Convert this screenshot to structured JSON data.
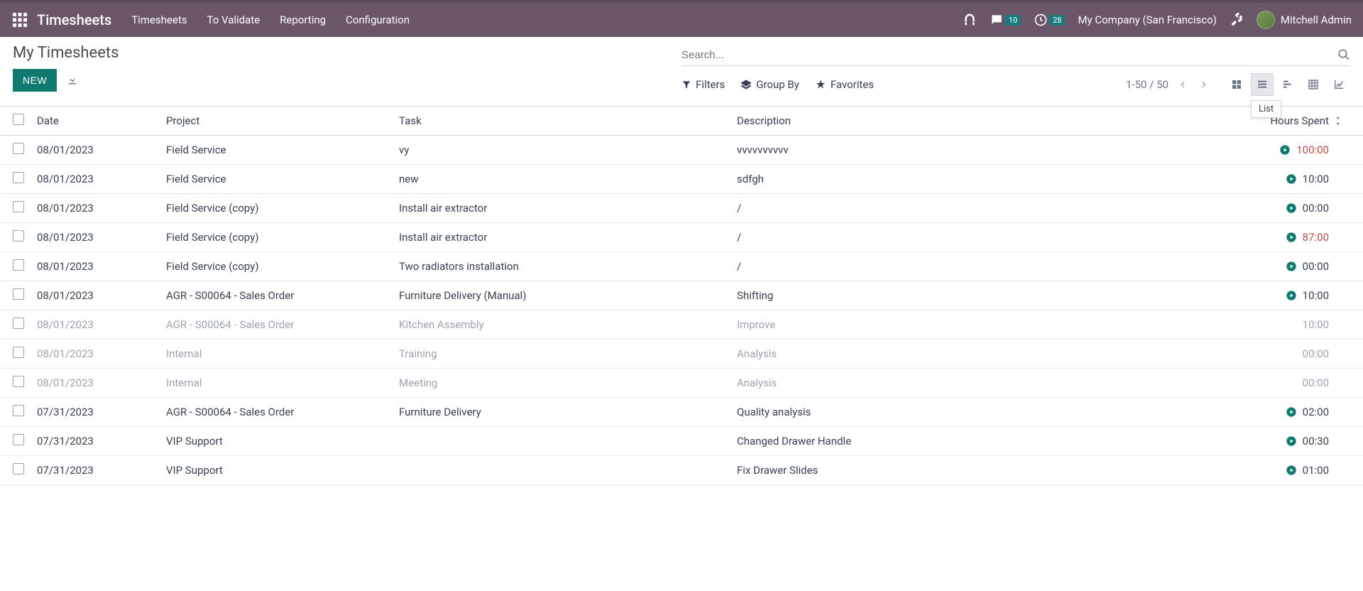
{
  "nav": {
    "brand": "Timesheets",
    "menu": [
      "Timesheets",
      "To Validate",
      "Reporting",
      "Configuration"
    ],
    "messages_badge": "10",
    "activities_badge": "28",
    "company": "My Company (San Francisco)",
    "user": "Mitchell Admin"
  },
  "breadcrumb": {
    "title": "My Timesheets"
  },
  "actions": {
    "new_label": "NEW"
  },
  "search": {
    "placeholder": "Search..."
  },
  "filters": {
    "filters_label": "Filters",
    "groupby_label": "Group By",
    "favorites_label": "Favorites"
  },
  "pager": {
    "range": "1-50",
    "sep": " / ",
    "total": "50"
  },
  "tooltip": {
    "list": "List"
  },
  "columns": {
    "date": "Date",
    "project": "Project",
    "task": "Task",
    "description": "Description",
    "hours": "Hours Spent"
  },
  "rows": [
    {
      "date": "08/01/2023",
      "project": "Field Service",
      "task": "vy",
      "desc": "vvvvvvvvvv",
      "hours": "100:00",
      "play": true,
      "red": true,
      "faded": false
    },
    {
      "date": "08/01/2023",
      "project": "Field Service",
      "task": "new",
      "desc": "sdfgh",
      "hours": "10:00",
      "play": true,
      "red": false,
      "faded": false
    },
    {
      "date": "08/01/2023",
      "project": "Field Service (copy)",
      "task": "Install air extractor",
      "desc": "/",
      "hours": "00:00",
      "play": true,
      "red": false,
      "faded": false
    },
    {
      "date": "08/01/2023",
      "project": "Field Service (copy)",
      "task": "Install air extractor",
      "desc": "/",
      "hours": "87:00",
      "play": true,
      "red": true,
      "faded": false
    },
    {
      "date": "08/01/2023",
      "project": "Field Service (copy)",
      "task": "Two radiators installation",
      "desc": "/",
      "hours": "00:00",
      "play": true,
      "red": false,
      "faded": false
    },
    {
      "date": "08/01/2023",
      "project": "AGR - S00064 - Sales Order",
      "task": "Furniture Delivery (Manual)",
      "desc": "Shifting",
      "hours": "10:00",
      "play": true,
      "red": false,
      "faded": false
    },
    {
      "date": "08/01/2023",
      "project": "AGR - S00064 - Sales Order",
      "task": "Kitchen Assembly",
      "desc": "Improve",
      "hours": "10:00",
      "play": false,
      "red": false,
      "faded": true
    },
    {
      "date": "08/01/2023",
      "project": "Internal",
      "task": "Training",
      "desc": "Analysis",
      "hours": "00:00",
      "play": false,
      "red": false,
      "faded": true
    },
    {
      "date": "08/01/2023",
      "project": "Internal",
      "task": "Meeting",
      "desc": "Analysis",
      "hours": "00:00",
      "play": false,
      "red": false,
      "faded": true
    },
    {
      "date": "07/31/2023",
      "project": "AGR - S00064 - Sales Order",
      "task": "Furniture Delivery",
      "desc": "Quality analysis",
      "hours": "02:00",
      "play": true,
      "red": false,
      "faded": false
    },
    {
      "date": "07/31/2023",
      "project": "VIP Support",
      "task": "",
      "desc": "Changed Drawer Handle",
      "hours": "00:30",
      "play": true,
      "red": false,
      "faded": false
    },
    {
      "date": "07/31/2023",
      "project": "VIP Support",
      "task": "",
      "desc": "Fix Drawer Slides",
      "hours": "01:00",
      "play": true,
      "red": false,
      "faded": false
    }
  ]
}
